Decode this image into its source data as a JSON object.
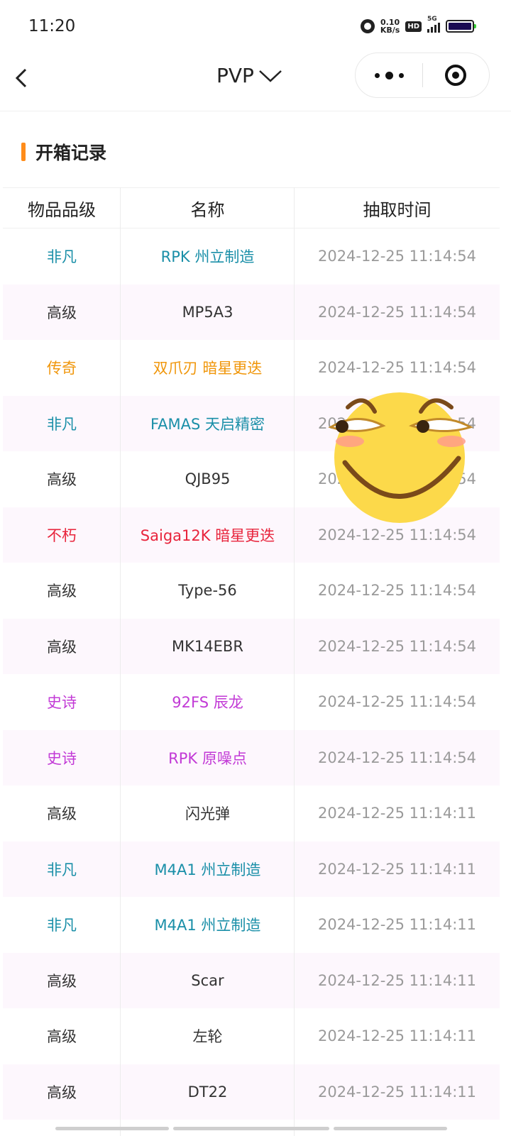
{
  "status_bar": {
    "time": "11:20",
    "speed_value": "0.10",
    "speed_unit": "KB/s",
    "hd_label": "HD",
    "network_label": "5G",
    "icons": [
      "alarm-icon",
      "hd-icon",
      "signal-icon",
      "battery-icon"
    ]
  },
  "nav": {
    "title": "PVP",
    "back_icon": "chevron-left-icon",
    "title_icon": "chevron-down-icon",
    "more_icon": "more-dots-icon",
    "close_icon": "target-icon"
  },
  "section": {
    "title": "开箱记录",
    "accent_color": "#ff8c1a"
  },
  "table": {
    "headers": [
      "物品品级",
      "名称",
      "抽取时间"
    ],
    "rows": [
      {
        "grade": "非凡",
        "name": "RPK 州立制造",
        "time": "2024-12-25 11:14:54",
        "color": "#1a8fa8"
      },
      {
        "grade": "高级",
        "name": "MP5A3",
        "time": "2024-12-25 11:14:54",
        "color": "#333333"
      },
      {
        "grade": "传奇",
        "name": "双爪刃 暗星更迭",
        "time": "2024-12-25 11:14:54",
        "color": "#f0960a"
      },
      {
        "grade": "非凡",
        "name": "FAMAS 天启精密",
        "time": "2024-12-25 11:14:54",
        "color": "#1a8fa8"
      },
      {
        "grade": "高级",
        "name": "QJB95",
        "time": "2024-12-25 11:14:54",
        "color": "#333333"
      },
      {
        "grade": "不朽",
        "name": "Saiga12K 暗星更迭",
        "time": "2024-12-25 11:14:54",
        "color": "#e8243c"
      },
      {
        "grade": "高级",
        "name": "Type-56",
        "time": "2024-12-25 11:14:54",
        "color": "#333333"
      },
      {
        "grade": "高级",
        "name": "MK14EBR",
        "time": "2024-12-25 11:14:54",
        "color": "#333333"
      },
      {
        "grade": "史诗",
        "name": "92FS 辰龙",
        "time": "2024-12-25 11:14:54",
        "color": "#c23ad6"
      },
      {
        "grade": "史诗",
        "name": "RPK 原噪点",
        "time": "2024-12-25 11:14:54",
        "color": "#c23ad6"
      },
      {
        "grade": "高级",
        "name": "闪光弹",
        "time": "2024-12-25 11:14:11",
        "color": "#333333"
      },
      {
        "grade": "非凡",
        "name": "M4A1 州立制造",
        "time": "2024-12-25 11:14:11",
        "color": "#1a8fa8"
      },
      {
        "grade": "非凡",
        "name": "M4A1 州立制造",
        "time": "2024-12-25 11:14:11",
        "color": "#1a8fa8"
      },
      {
        "grade": "高级",
        "name": "Scar",
        "time": "2024-12-25 11:14:11",
        "color": "#333333"
      },
      {
        "grade": "高级",
        "name": "左轮",
        "time": "2024-12-25 11:14:11",
        "color": "#333333"
      },
      {
        "grade": "高级",
        "name": "DT22",
        "time": "2024-12-25 11:14:11",
        "color": "#333333"
      }
    ]
  },
  "overlay": {
    "emoji_icon": "smirk-emoji-icon"
  }
}
